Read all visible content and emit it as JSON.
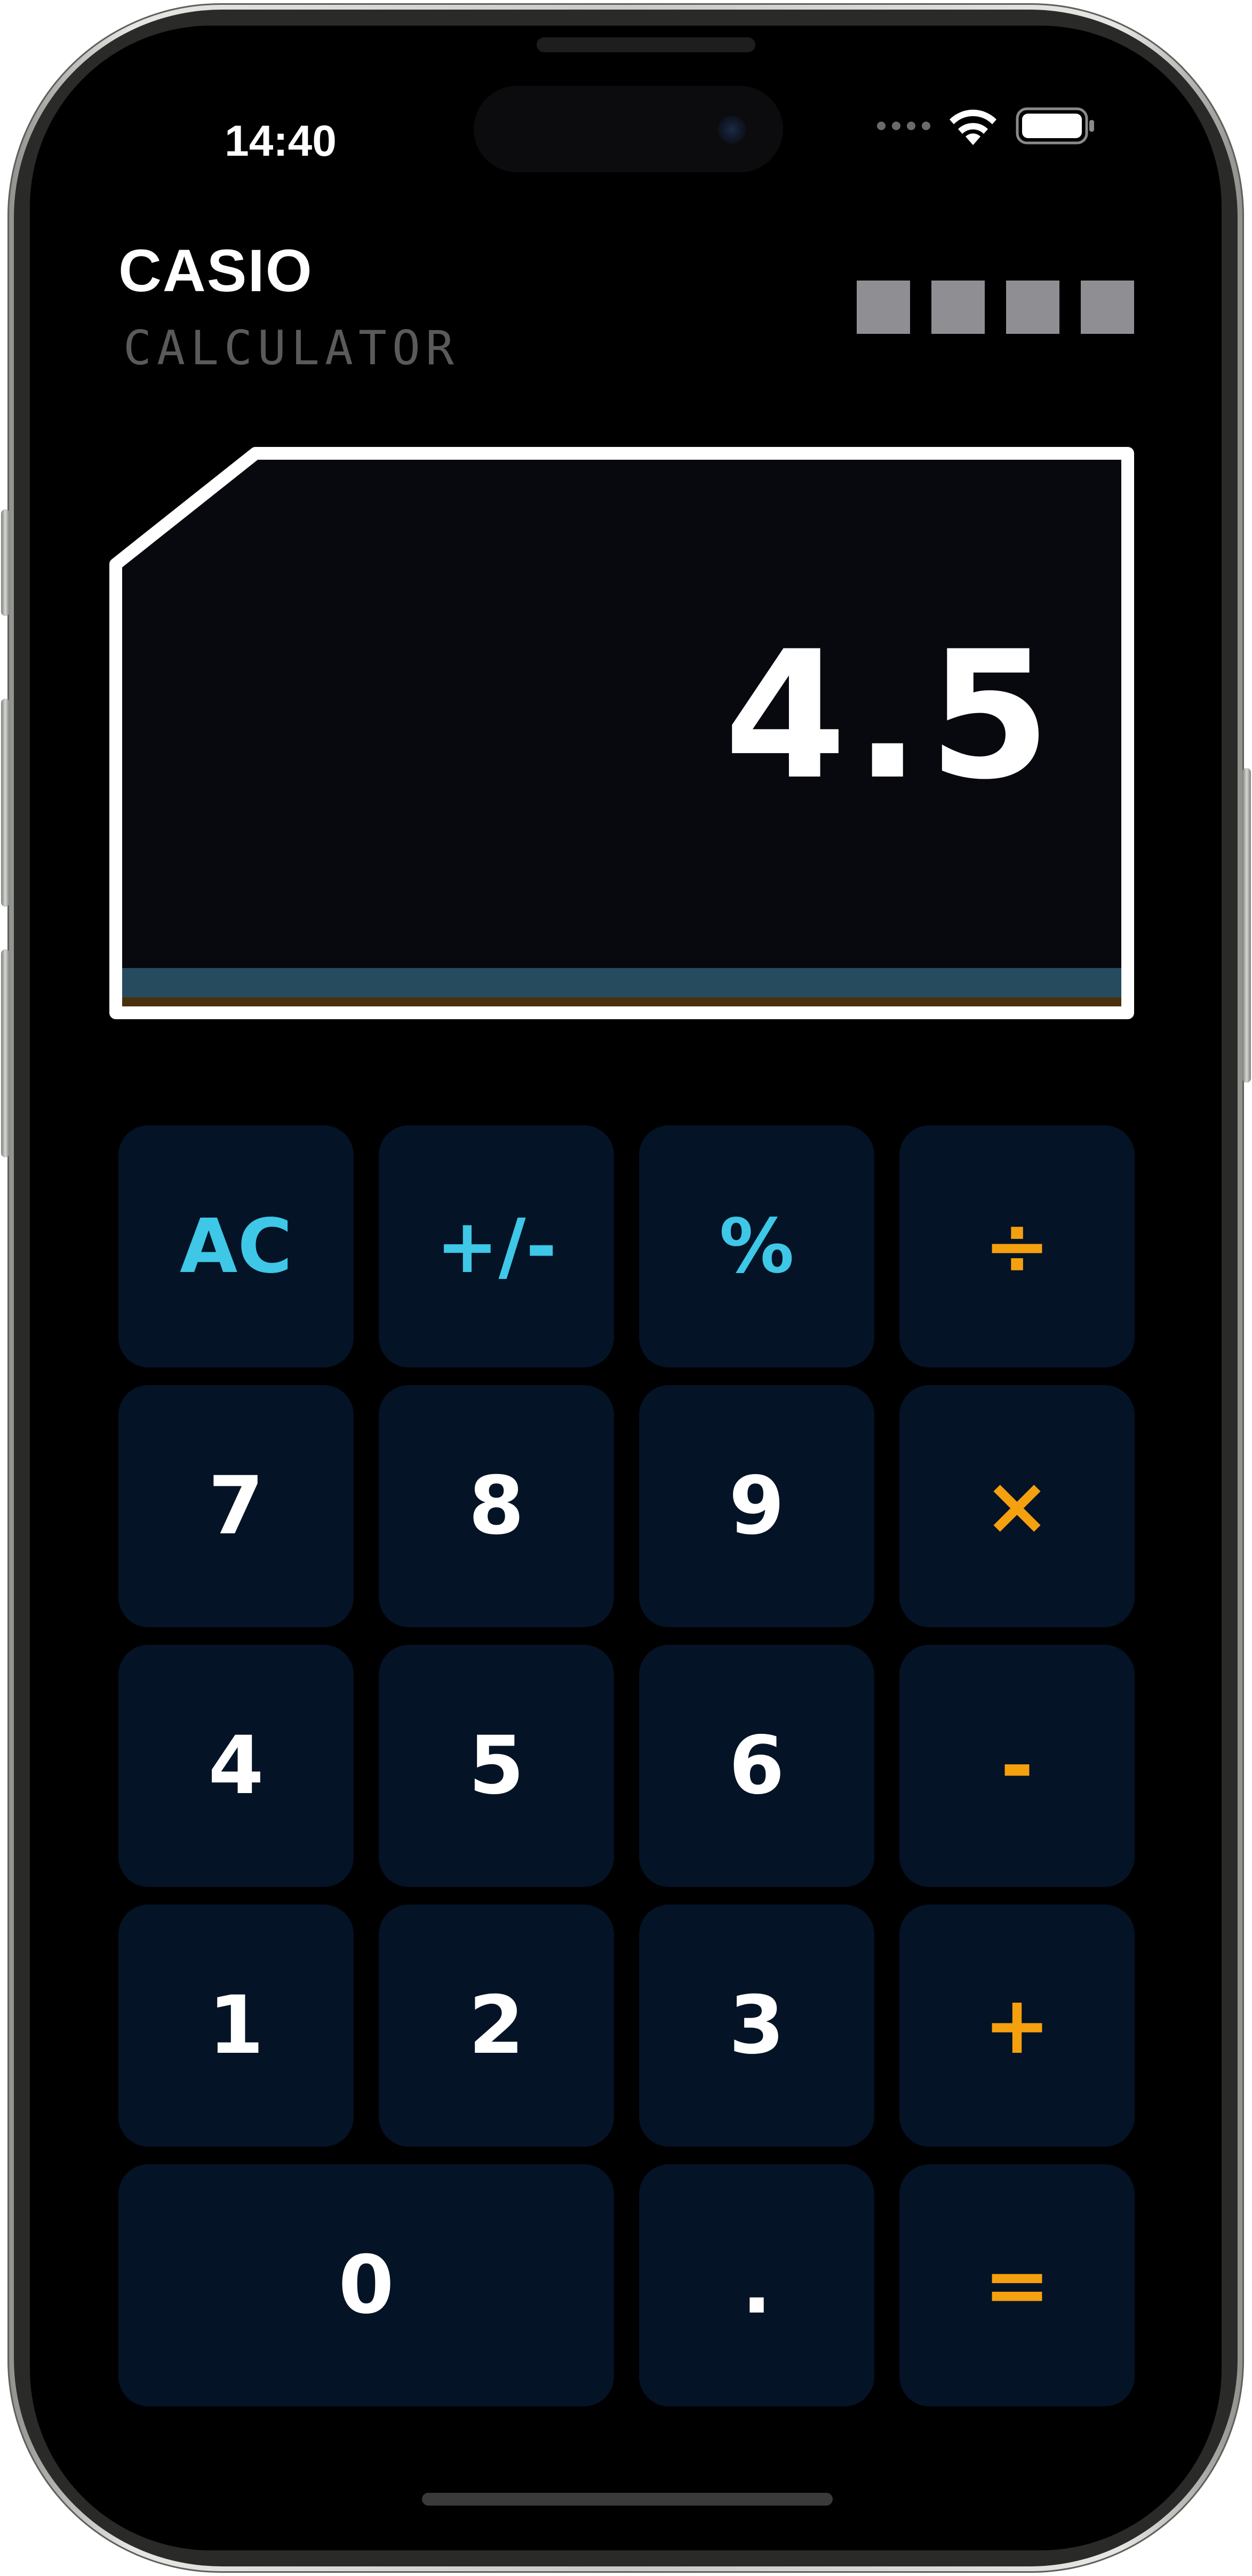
{
  "status_bar": {
    "time": "14:40",
    "icons": [
      "signal-dots-icon",
      "wifi-icon",
      "battery-icon"
    ]
  },
  "header": {
    "brand": "CASIO",
    "subtitle": "CALCULATOR",
    "indicator_count": 4
  },
  "display": {
    "value": "4.5"
  },
  "keypad": {
    "rows": [
      [
        {
          "label": "AC",
          "kind": "func"
        },
        {
          "label": "+/-",
          "kind": "func"
        },
        {
          "label": "%",
          "kind": "func"
        },
        {
          "label": "÷",
          "kind": "op"
        }
      ],
      [
        {
          "label": "7",
          "kind": "digit"
        },
        {
          "label": "8",
          "kind": "digit"
        },
        {
          "label": "9",
          "kind": "digit"
        },
        {
          "label": "×",
          "kind": "op"
        }
      ],
      [
        {
          "label": "4",
          "kind": "digit"
        },
        {
          "label": "5",
          "kind": "digit"
        },
        {
          "label": "6",
          "kind": "digit"
        },
        {
          "label": "-",
          "kind": "op"
        }
      ],
      [
        {
          "label": "1",
          "kind": "digit"
        },
        {
          "label": "2",
          "kind": "digit"
        },
        {
          "label": "3",
          "kind": "digit"
        },
        {
          "label": "+",
          "kind": "op"
        }
      ],
      [
        {
          "label": "0",
          "kind": "digit"
        },
        {
          "label": ".",
          "kind": "digit"
        },
        {
          "label": "=",
          "kind": "op"
        }
      ]
    ]
  },
  "colors": {
    "background": "#000000",
    "key_background": "#041326",
    "function_key_text": "#3ec7e6",
    "operator_key_text": "#f5a00f",
    "digit_key_text": "#ffffff",
    "display_background": "#07090e",
    "display_stripe_blue": "#264a5e",
    "display_stripe_brown": "#4a300d",
    "indicator_squares": "#8e8e93"
  }
}
